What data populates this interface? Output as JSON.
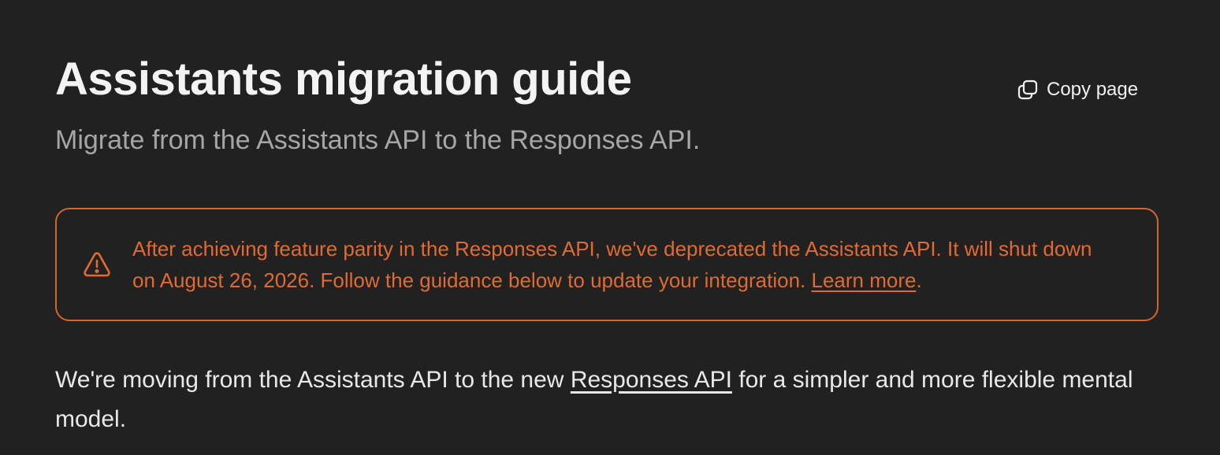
{
  "header": {
    "title": "Assistants migration guide",
    "subtitle": "Migrate from the Assistants API to the Responses API.",
    "copy_page_label": "Copy page",
    "copy_icon": "copy-icon"
  },
  "callout": {
    "icon": "warning-icon",
    "text_before_link": "After achieving feature parity in the Responses API, we've deprecated the Assistants API. It will shut down on August 26, 2026. Follow the guidance below to update your integration. ",
    "link_label": "Learn more",
    "text_after_link": ".",
    "accent_color": "#e06a33"
  },
  "body": {
    "text_before_link": "We're moving from the Assistants API to the new ",
    "link_label": "Responses API",
    "text_after_link": " for a simpler and more flexible mental model."
  },
  "colors": {
    "background": "#212121",
    "title": "#f3f3f3",
    "subtitle": "#a6a6a6",
    "warning": "#d2662f"
  }
}
